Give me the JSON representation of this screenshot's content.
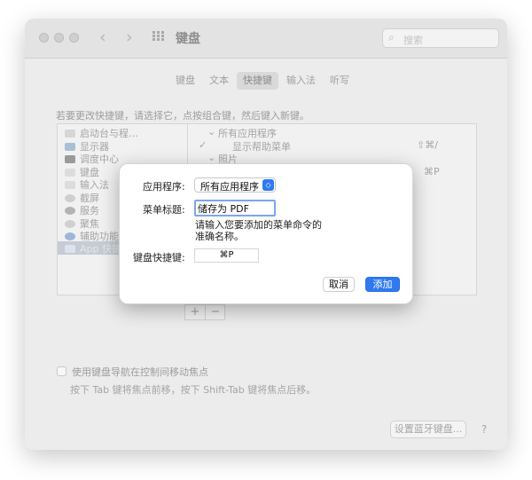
{
  "window": {
    "title": "键盘",
    "search_placeholder": "搜索",
    "tabs": [
      {
        "label": "键盘",
        "active": false
      },
      {
        "label": "文本",
        "active": false
      },
      {
        "label": "快捷键",
        "active": true
      },
      {
        "label": "输入法",
        "active": false
      },
      {
        "label": "听写",
        "active": false
      }
    ],
    "instruction": "若要更改快捷键，请选择它，点按组合键，然后键入新键。",
    "categories": [
      {
        "label": "启动台与程…",
        "icon": "launchpad-icon"
      },
      {
        "label": "显示器",
        "icon": "display-icon"
      },
      {
        "label": "调度中心",
        "icon": "mission-control-icon"
      },
      {
        "label": "键盘",
        "icon": "keyboard-icon"
      },
      {
        "label": "输入法",
        "icon": "input-method-icon"
      },
      {
        "label": "截屏",
        "icon": "screenshot-icon"
      },
      {
        "label": "服务",
        "icon": "services-icon"
      },
      {
        "label": "聚焦",
        "icon": "spotlight-icon"
      },
      {
        "label": "辅助功能",
        "icon": "accessibility-icon"
      },
      {
        "label": "App 快捷",
        "icon": "app-shortcuts-icon",
        "selected": true
      }
    ],
    "shortcuts": {
      "group1": "所有应用程序",
      "item1": "显示帮助菜单",
      "item1_key": "⇧⌘/",
      "group2": "照片",
      "item2_key": "⌘P"
    },
    "add_label": "+",
    "remove_label": "−",
    "keyboard_nav_label": "使用键盘导航在控制间移动焦点",
    "keyboard_nav_hint": "按下 Tab 键将焦点前移，按下 Shift-Tab 键将焦点后移。",
    "bluetooth_button": "设置蓝牙键盘...",
    "help_button": "?"
  },
  "dialog": {
    "app_label": "应用程序:",
    "app_value": "所有应用程序",
    "menu_title_label": "菜单标题:",
    "menu_title_value": "储存为 PDF",
    "hint": "请输入您要添加的菜单命令的\n准确名称。",
    "shortcut_label": "键盘快捷键:",
    "shortcut_value": "⌘P",
    "cancel": "取消",
    "add": "添加"
  },
  "colors": {
    "accent": "#2f7af0",
    "focus_ring": "#7aa7ee"
  }
}
